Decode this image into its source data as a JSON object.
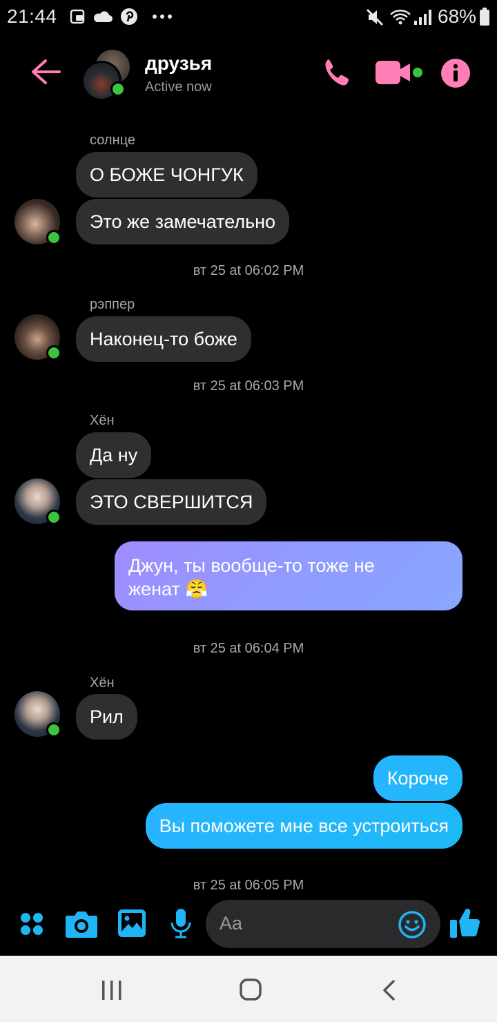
{
  "status_bar": {
    "time": "21:44",
    "battery": "68%",
    "icons": [
      "screenshot-icon",
      "cloud-icon",
      "pinterest-icon",
      "more-dots-icon",
      "mute-icon",
      "wifi-icon",
      "signal-icon",
      "battery-icon"
    ]
  },
  "header": {
    "title": "друзья",
    "status": "Active now",
    "accent": "#ff7eb6",
    "icons": [
      "back-arrow-icon",
      "phone-icon",
      "video-camera-icon",
      "info-icon"
    ]
  },
  "messages": {
    "g1": {
      "sender": "солнце",
      "m1": "О БОЖЕ ЧОНГУК",
      "m2": "Это же замечательно"
    },
    "t1": "вт 25 at 06:02 PM",
    "g2": {
      "sender": "рэппер",
      "m1": "Наконец-то боже"
    },
    "t2": "вт 25 at 06:03 PM",
    "g3": {
      "sender": "Хён",
      "m1": "Да ну",
      "m2": "ЭТО СВЕРШИТСЯ"
    },
    "out1": {
      "line1": "Джун, ты вообще-то тоже не",
      "line2": "женат 😤"
    },
    "t3": "вт 25 at 06:04 PM",
    "g4": {
      "sender": "Хён",
      "m1": "Рил"
    },
    "out2": {
      "m1": "Короче",
      "m2": "Вы поможете мне все устроиться"
    },
    "t4": "вт 25 at 06:05 PM"
  },
  "composer": {
    "placeholder": "Aa",
    "accent": "#1fb6f5",
    "icons": [
      "apps-icon",
      "camera-icon",
      "gallery-icon",
      "microphone-icon",
      "emoji-icon",
      "thumbs-up-icon"
    ]
  },
  "nav": {
    "icons": [
      "recents-icon",
      "home-icon",
      "back-icon"
    ]
  }
}
